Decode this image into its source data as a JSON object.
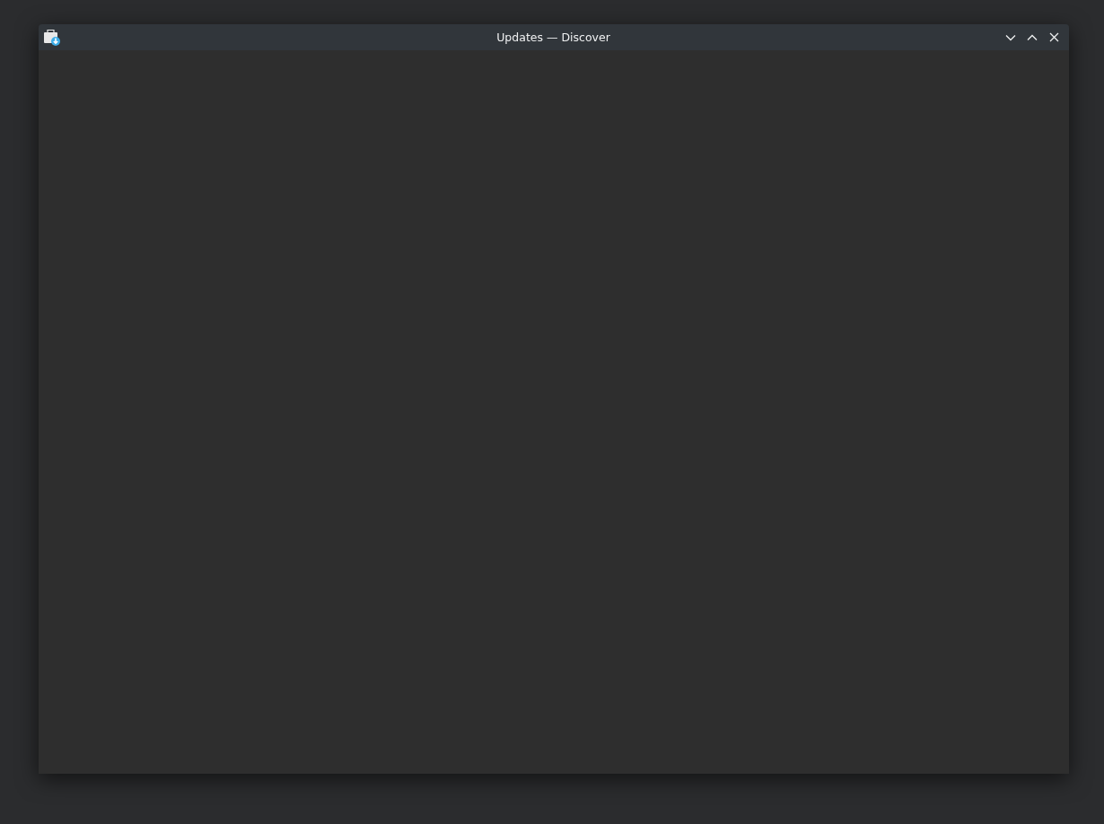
{
  "window": {
    "title": "Updates — Discover"
  }
}
